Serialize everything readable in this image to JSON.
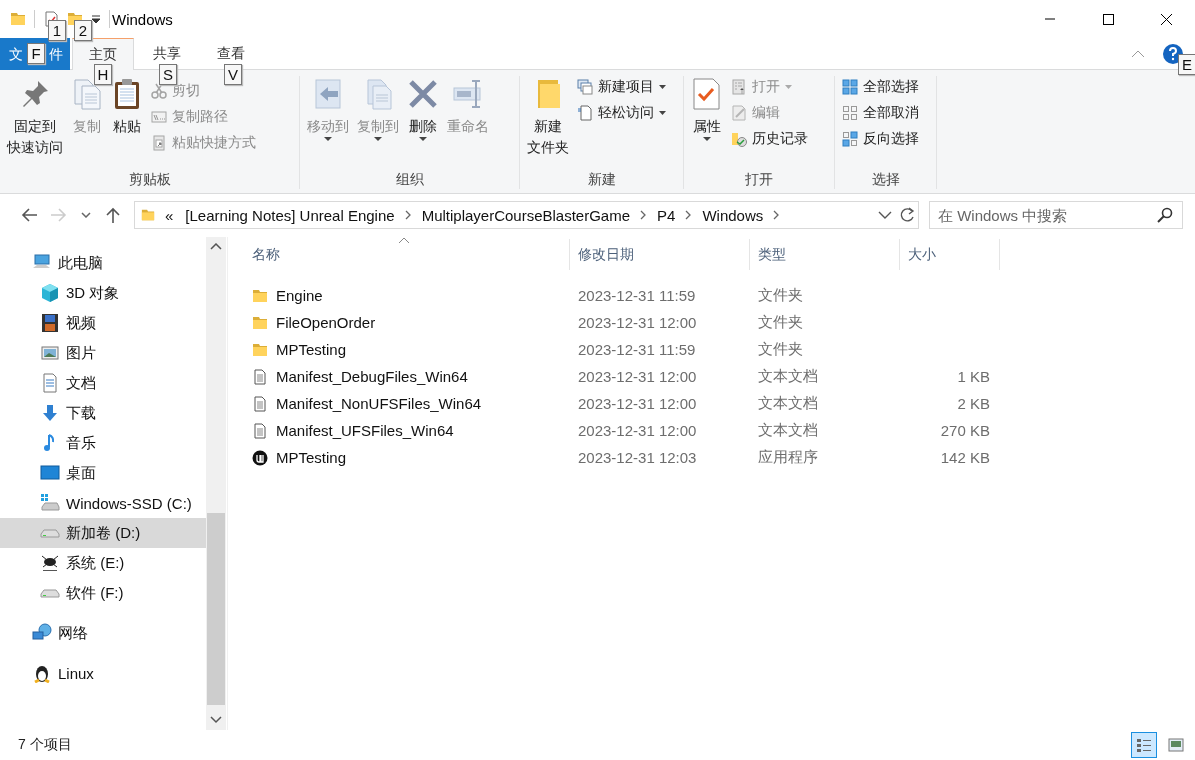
{
  "window": {
    "title": "Windows"
  },
  "keytips": [
    {
      "label": "1"
    },
    {
      "label": "2"
    },
    {
      "label": "F"
    },
    {
      "label": "H"
    },
    {
      "label": "S"
    },
    {
      "label": "V"
    },
    {
      "label": "E"
    }
  ],
  "ribbon": {
    "tabs": [
      {
        "label": "文件",
        "kind": "file",
        "selected": false
      },
      {
        "label": "主页",
        "kind": "tab",
        "selected": true
      },
      {
        "label": "共享",
        "kind": "tab",
        "selected": false
      },
      {
        "label": "查看",
        "kind": "tab",
        "selected": false
      }
    ],
    "groups": [
      {
        "label": "剪贴板",
        "items": [
          {
            "kind": "large",
            "lines": [
              "固定到",
              "快速访问"
            ],
            "disabled": false,
            "dropdown": false
          },
          {
            "kind": "large",
            "lines": [
              "复制"
            ],
            "disabled": true,
            "dropdown": false
          },
          {
            "kind": "large",
            "lines": [
              "粘贴"
            ],
            "disabled": false,
            "dropdown": false
          },
          {
            "kind": "stack",
            "commands": [
              {
                "label": "剪切",
                "disabled": true,
                "dropdown": false
              },
              {
                "label": "复制路径",
                "disabled": true,
                "dropdown": false
              },
              {
                "label": "粘贴快捷方式",
                "disabled": true,
                "dropdown": false
              }
            ]
          }
        ]
      },
      {
        "label": "组织",
        "items": [
          {
            "kind": "large",
            "lines": [
              "移动到"
            ],
            "disabled": true,
            "dropdown": true
          },
          {
            "kind": "large",
            "lines": [
              "复制到"
            ],
            "disabled": true,
            "dropdown": true
          },
          {
            "kind": "large",
            "lines": [
              "删除"
            ],
            "disabled": false,
            "dropdown": true
          },
          {
            "kind": "large",
            "lines": [
              "重命名"
            ],
            "disabled": true,
            "dropdown": false
          }
        ]
      },
      {
        "label": "新建",
        "items": [
          {
            "kind": "large",
            "lines": [
              "新建",
              "文件夹"
            ],
            "disabled": false,
            "dropdown": false
          },
          {
            "kind": "stack",
            "commands": [
              {
                "label": "新建项目",
                "disabled": false,
                "dropdown": true
              },
              {
                "label": "轻松访问",
                "disabled": false,
                "dropdown": true
              }
            ]
          }
        ]
      },
      {
        "label": "打开",
        "items": [
          {
            "kind": "large",
            "lines": [
              "属性"
            ],
            "disabled": false,
            "dropdown": true
          },
          {
            "kind": "stack",
            "commands": [
              {
                "label": "打开",
                "disabled": true,
                "dropdown": true
              },
              {
                "label": "编辑",
                "disabled": true,
                "dropdown": false
              },
              {
                "label": "历史记录",
                "disabled": false,
                "dropdown": false
              }
            ]
          }
        ]
      },
      {
        "label": "选择",
        "items": [
          {
            "kind": "stack",
            "commands": [
              {
                "label": "全部选择",
                "disabled": false,
                "dropdown": false
              },
              {
                "label": "全部取消",
                "disabled": false,
                "dropdown": false
              },
              {
                "label": "反向选择",
                "disabled": false,
                "dropdown": false
              }
            ]
          }
        ]
      }
    ]
  },
  "address": {
    "back_disabled": false,
    "forward_disabled": true,
    "overflow": "«",
    "breadcrumb": [
      "[Learning Notes] Unreal Engine",
      "MultiplayerCourseBlasterGame",
      "P4",
      "Windows"
    ],
    "search": {
      "placeholder": "在 Windows 中搜索"
    }
  },
  "sidebar": {
    "items": [
      {
        "label": "此电脑",
        "kind": "pc",
        "selected": false,
        "children": [
          {
            "label": "3D 对象",
            "kind": "cube",
            "selected": false
          },
          {
            "label": "视频",
            "kind": "video",
            "selected": false
          },
          {
            "label": "图片",
            "kind": "picture",
            "selected": false
          },
          {
            "label": "文档",
            "kind": "document",
            "selected": false
          },
          {
            "label": "下载",
            "kind": "download",
            "selected": false
          },
          {
            "label": "音乐",
            "kind": "music",
            "selected": false
          },
          {
            "label": "桌面",
            "kind": "desktop",
            "selected": false
          },
          {
            "label": "Windows-SSD (C:)",
            "kind": "system-drive",
            "selected": false
          },
          {
            "label": "新加卷 (D:)",
            "kind": "drive",
            "selected": true
          },
          {
            "label": "系统 (E:)",
            "kind": "custom-drive",
            "selected": false
          },
          {
            "label": "软件 (F:)",
            "kind": "drive",
            "selected": false
          }
        ]
      },
      {
        "label": "网络",
        "kind": "network",
        "selected": false
      },
      {
        "label": "Linux",
        "kind": "linux",
        "selected": false
      }
    ]
  },
  "table": {
    "columns": [
      "名称",
      "修改日期",
      "类型",
      "大小"
    ],
    "rows": [
      {
        "kind": "folder",
        "name": "Engine",
        "modified": "2023-12-31 11:59",
        "type": "文件夹"
      },
      {
        "kind": "folder",
        "name": "FileOpenOrder",
        "modified": "2023-12-31 12:00",
        "type": "文件夹"
      },
      {
        "kind": "folder",
        "name": "MPTesting",
        "modified": "2023-12-31 11:59",
        "type": "文件夹"
      },
      {
        "kind": "text",
        "name": "Manifest_DebugFiles_Win64",
        "modified": "2023-12-31 12:00",
        "type": "文本文档",
        "size": "1 KB"
      },
      {
        "kind": "text",
        "name": "Manifest_NonUFSFiles_Win64",
        "modified": "2023-12-31 12:00",
        "type": "文本文档",
        "size": "2 KB"
      },
      {
        "kind": "text",
        "name": "Manifest_UFSFiles_Win64",
        "modified": "2023-12-31 12:00",
        "type": "文本文档",
        "size": "270 KB"
      },
      {
        "kind": "app",
        "name": "MPTesting",
        "modified": "2023-12-31 12:03",
        "type": "应用程序",
        "size": "142 KB"
      }
    ]
  },
  "status_bar": {
    "text": "7 个项目",
    "views": [
      {
        "kind": "details",
        "selected": true
      },
      {
        "kind": "large-icons",
        "selected": false
      }
    ]
  }
}
